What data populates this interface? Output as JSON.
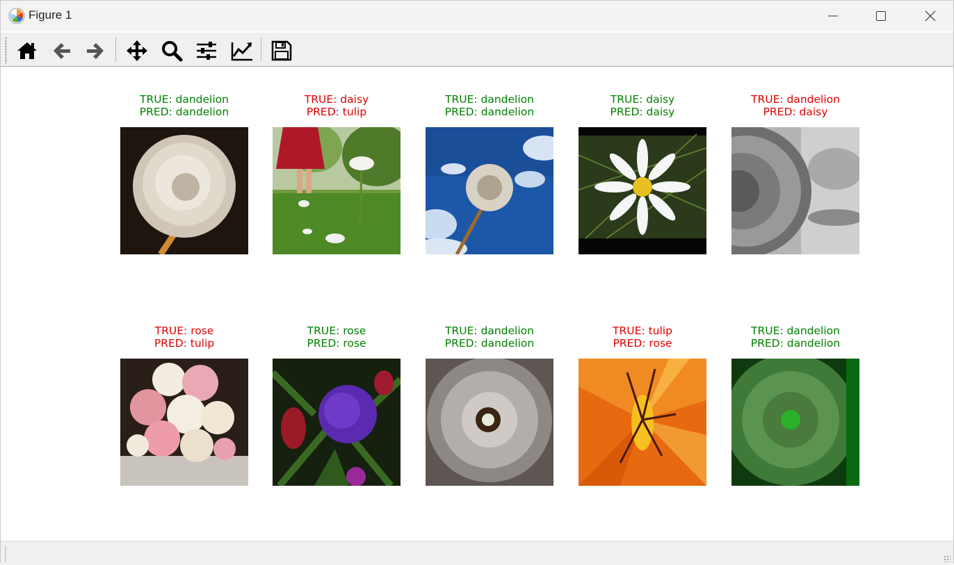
{
  "window": {
    "title": "Figure 1",
    "icons": {
      "app": "matplotlib-logo-icon",
      "minimize": "minimize-icon",
      "maximize": "maximize-icon",
      "close": "close-icon"
    }
  },
  "toolbar": {
    "buttons": [
      {
        "name": "home",
        "icon": "home-icon"
      },
      {
        "name": "back",
        "icon": "arrow-left-icon"
      },
      {
        "name": "forward",
        "icon": "arrow-right-icon"
      },
      {
        "name": "pan",
        "icon": "move-arrows-icon"
      },
      {
        "name": "zoom",
        "icon": "magnifier-icon"
      },
      {
        "name": "configure-subplots",
        "icon": "sliders-icon"
      },
      {
        "name": "edit-axes",
        "icon": "line-chart-icon"
      },
      {
        "name": "save",
        "icon": "floppy-disk-icon"
      }
    ]
  },
  "colors": {
    "correct": "#008000",
    "incorrect": "#e00000"
  },
  "figure": {
    "tiles": [
      {
        "true_label": "TRUE: dandelion",
        "pred_label": "PRED: dandelion",
        "status": "correct",
        "image": "dandelion seed head on dark background"
      },
      {
        "true_label": "TRUE: daisy",
        "pred_label": "PRED: tulip",
        "status": "incorrect",
        "image": "daisy in grass with red skirt"
      },
      {
        "true_label": "TRUE: dandelion",
        "pred_label": "PRED: dandelion",
        "status": "correct",
        "image": "dandelion against blue sky"
      },
      {
        "true_label": "TRUE: daisy",
        "pred_label": "PRED: daisy",
        "status": "correct",
        "image": "white daisy with yellow center"
      },
      {
        "true_label": "TRUE: dandelion",
        "pred_label": "PRED: daisy",
        "status": "incorrect",
        "image": "grayscale dandelion close-up"
      },
      {
        "true_label": "TRUE: rose",
        "pred_label": "PRED: tulip",
        "status": "incorrect",
        "image": "pink and white rose bouquet"
      },
      {
        "true_label": "TRUE: rose",
        "pred_label": "PRED: rose",
        "status": "correct",
        "image": "purple rose with green leaves"
      },
      {
        "true_label": "TRUE: dandelion",
        "pred_label": "PRED: dandelion",
        "status": "correct",
        "image": "dandelion seed head close-up"
      },
      {
        "true_label": "TRUE: tulip",
        "pred_label": "PRED: rose",
        "status": "incorrect",
        "image": "orange lily close-up"
      },
      {
        "true_label": "TRUE: dandelion",
        "pred_label": "PRED: dandelion",
        "status": "correct",
        "image": "green tinted dandelion close-up"
      }
    ]
  }
}
